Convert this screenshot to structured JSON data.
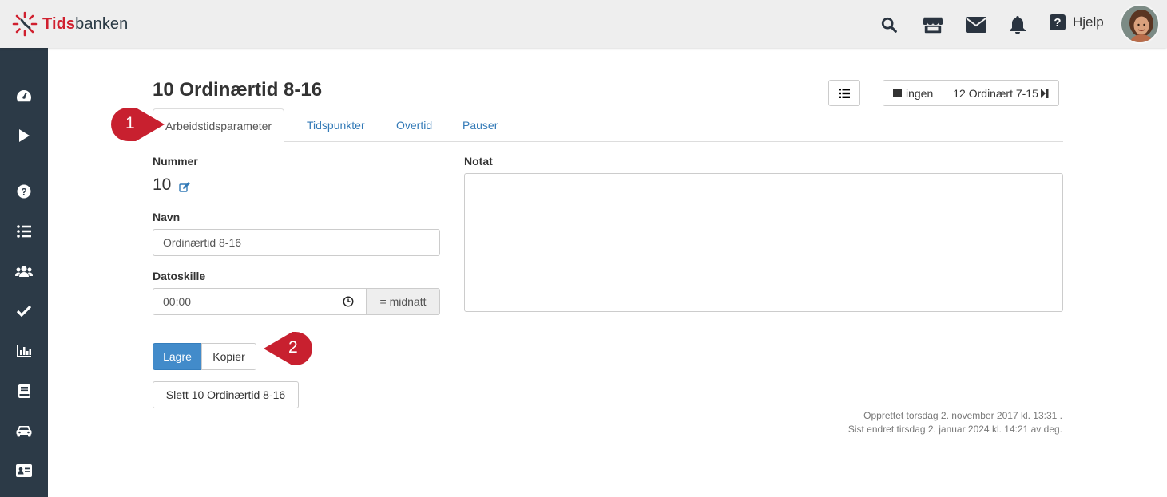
{
  "header": {
    "logo_part1": "Tids",
    "logo_part2": "banken",
    "icons": [
      "search-icon",
      "store-icon",
      "envelope-icon",
      "bell-icon"
    ],
    "help_label": "Hjelp"
  },
  "sidebar": {
    "icons": [
      "dashboard-icon",
      "play-icon",
      "question-icon",
      "list-icon",
      "users-icon",
      "check-icon",
      "bar-chart-icon",
      "book-icon",
      "car-icon",
      "id-card-icon"
    ]
  },
  "page": {
    "title": "10 Ordinærtid 8-16",
    "nav": {
      "prev_label": "ingen",
      "next_label": "12 Ordinært 7-15"
    }
  },
  "tabs": [
    {
      "label": "Arbeidstidsparameter",
      "active": true
    },
    {
      "label": "Tidspunkter",
      "active": false
    },
    {
      "label": "Overtid",
      "active": false
    },
    {
      "label": "Pauser",
      "active": false
    }
  ],
  "callouts": {
    "first": "1",
    "second": "2"
  },
  "form": {
    "nummer_label": "Nummer",
    "nummer_value": "10",
    "navn_label": "Navn",
    "navn_value": "Ordinærtid 8-16",
    "datoskille_label": "Datoskille",
    "datoskille_value": "00:00",
    "datoskille_addon": "= midnatt",
    "notat_label": "Notat",
    "notat_value": ""
  },
  "buttons": {
    "save": "Lagre",
    "copy": "Kopier",
    "delete": "Slett 10 Ordinærtid 8-16"
  },
  "meta": {
    "created": "Opprettet torsdag 2. november 2017 kl. 13:31 .",
    "modified": "Sist endret tirsdag 2. januar 2024 kl. 14:21 av deg."
  },
  "colors": {
    "sidebar_bg": "#2c3a47",
    "topbar_bg": "#eeeeee",
    "primary": "#428bca",
    "link": "#337ab7",
    "callout": "#c8202f",
    "brand_red": "#d0202f"
  }
}
